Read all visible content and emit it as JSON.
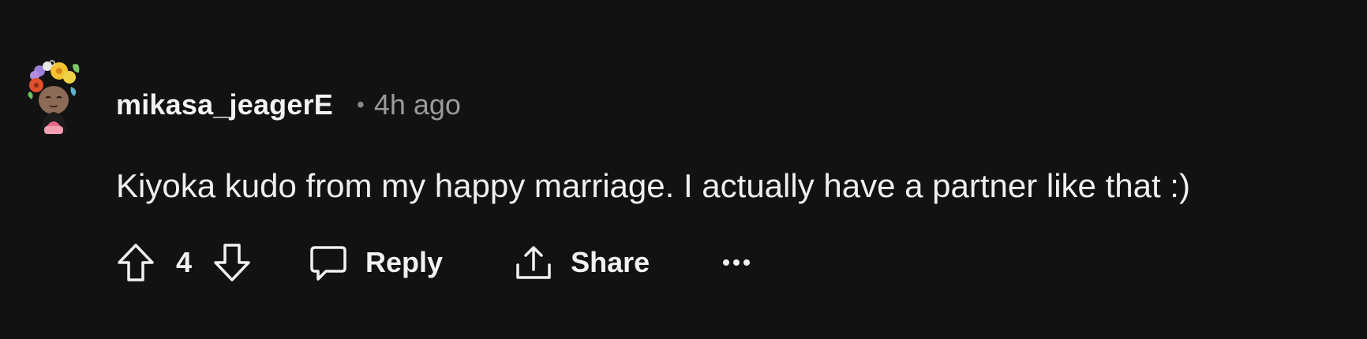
{
  "comment": {
    "avatar_icon": "user-avatar-flower-crown",
    "username": "mikasa_jeagerE",
    "separator": "•",
    "timestamp": "4h ago",
    "text": "Kiyoka kudo from my happy marriage. I actually have a partner like that :)"
  },
  "actions": {
    "upvote_icon": "arrow-up-icon",
    "vote_count": "4",
    "downvote_icon": "arrow-down-icon",
    "reply_label": "Reply",
    "share_label": "Share",
    "more_icon": "ellipsis-icon"
  },
  "colors": {
    "background": "#121212",
    "text": "#f2f2f2",
    "muted": "#9a9a9a"
  }
}
